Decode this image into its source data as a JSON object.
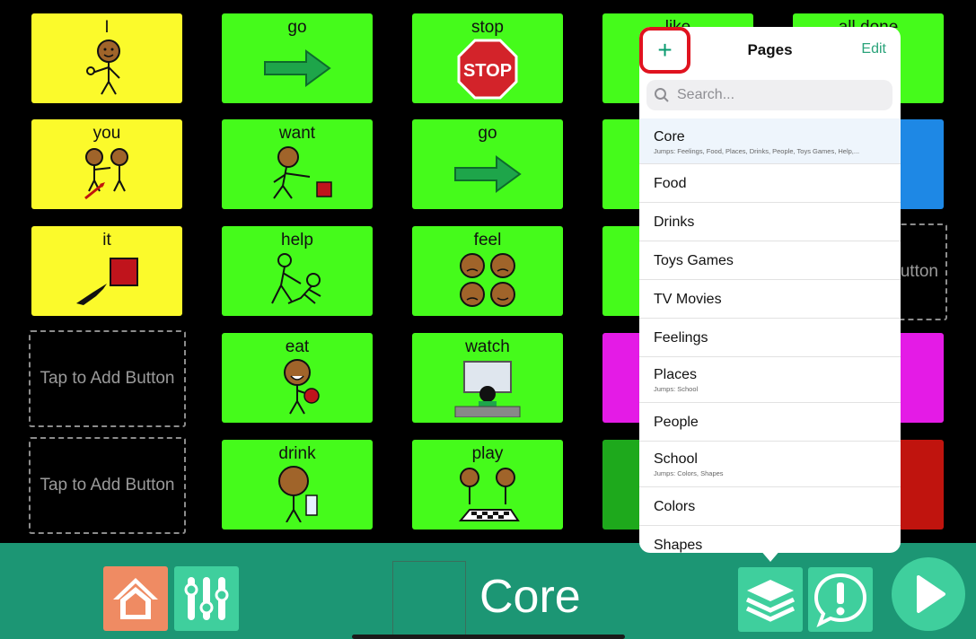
{
  "tiles": {
    "i": "I",
    "you": "you",
    "it": "it",
    "go1": "go",
    "want": "want",
    "help": "help",
    "eat": "eat",
    "drink": "drink",
    "stop": "stop",
    "stop_sign": "STOP",
    "go2": "go",
    "feel": "feel",
    "watch": "watch",
    "play": "play",
    "like": "like",
    "all_done": "all done",
    "empty1": "Tap to Add Button",
    "empty2": "Tap to Add Button",
    "empty_partial": "utton"
  },
  "popover": {
    "title": "Pages",
    "edit": "Edit",
    "add": "+",
    "search_placeholder": "Search...",
    "pages": [
      {
        "name": "Core",
        "jumps": "Jumps: Feelings, Food, Places, Drinks, People, Toys Games, Help,..."
      },
      {
        "name": "Food",
        "jumps": ""
      },
      {
        "name": "Drinks",
        "jumps": ""
      },
      {
        "name": "Toys Games",
        "jumps": ""
      },
      {
        "name": "TV Movies",
        "jumps": ""
      },
      {
        "name": "Feelings",
        "jumps": ""
      },
      {
        "name": "Places",
        "jumps": "Jumps: School"
      },
      {
        "name": "People",
        "jumps": ""
      },
      {
        "name": "School",
        "jumps": "Jumps: Colors, Shapes"
      },
      {
        "name": "Colors",
        "jumps": ""
      },
      {
        "name": "Shapes",
        "jumps": ""
      }
    ]
  },
  "bottombar": {
    "page_name": "Core"
  },
  "colors": {
    "yellow": "#fbfa2b",
    "green": "#45fb1b",
    "bar": "#1c9674",
    "accent": "#2aa37a",
    "highlight": "#e0131f"
  },
  "icons": [
    "home-icon",
    "sliders-icon",
    "layers-icon",
    "alert-bubble-icon",
    "play-icon",
    "search-icon",
    "plus-icon"
  ]
}
